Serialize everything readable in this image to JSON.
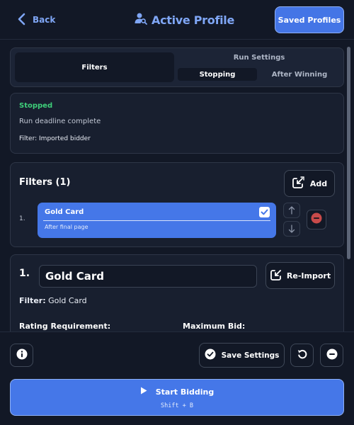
{
  "header": {
    "back_label": "Back",
    "title": "Active Profile",
    "saved_profiles_label": "Saved Profiles"
  },
  "tabs": {
    "filters_label": "Filters",
    "run_settings_label": "Run Settings",
    "subtabs": [
      {
        "label": "Stopping",
        "active": true
      },
      {
        "label": "After Winning",
        "active": false
      }
    ]
  },
  "status": {
    "state": "Stopped",
    "message": "Run deadline complete",
    "filter_text": "Filter: Imported bidder"
  },
  "filters_panel": {
    "title": "Filters (1)",
    "add_label": "Add",
    "items": [
      {
        "index": "1.",
        "name": "Gold Card",
        "subtitle": "After final page",
        "checked": true
      }
    ]
  },
  "detail": {
    "index": "1.",
    "name_value": "Gold Card",
    "reimport_label": "Re-Import",
    "filter_label": "Filter:",
    "filter_value": "Gold Card",
    "rating_label": "Rating Requirement:",
    "max_bid_label": "Maximum Bid:"
  },
  "bottom": {
    "save_label": "Save Settings",
    "start_label": "Start Bidding",
    "start_shortcut": "Shift + B"
  },
  "colors": {
    "accent": "#4577e8",
    "accent_text": "#7fa6f5",
    "background": "#121826",
    "status_green": "#3ecf7a",
    "danger": "#c84a4a"
  }
}
